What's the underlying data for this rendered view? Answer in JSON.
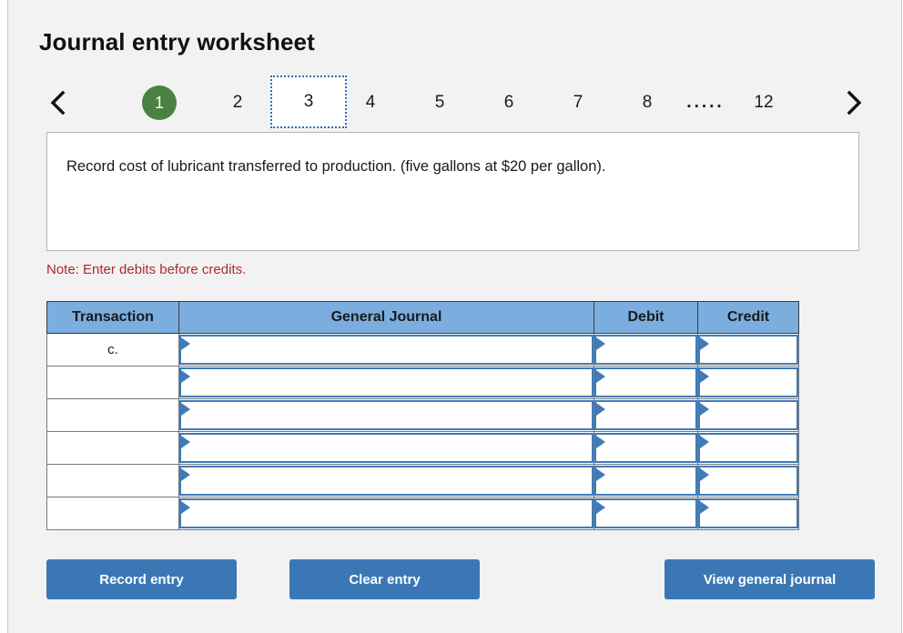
{
  "page": {
    "title": "Journal entry worksheet"
  },
  "pager": {
    "prev_icon": "chevron-left-icon",
    "next_icon": "chevron-right-icon",
    "ellipsis": ".....",
    "current_page": "1",
    "selected_page": "3",
    "items": [
      {
        "label": "1",
        "state": "current"
      },
      {
        "label": "2",
        "state": "normal"
      },
      {
        "label": "3",
        "state": "selected"
      },
      {
        "label": "4",
        "state": "normal"
      },
      {
        "label": "5",
        "state": "normal"
      },
      {
        "label": "6",
        "state": "normal"
      },
      {
        "label": "7",
        "state": "normal"
      },
      {
        "label": "8",
        "state": "normal"
      },
      {
        "label": "12",
        "state": "normal"
      }
    ],
    "current_color": "#4a8041",
    "selected_border_color": "#2e6fb7"
  },
  "description": {
    "text": "Record cost of lubricant transferred to production. (five gallons at $20 per gallon)."
  },
  "note": {
    "text": "Note: Enter debits before credits.",
    "color": "#b02a2a"
  },
  "table": {
    "headers": {
      "transaction": "Transaction",
      "general_journal": "General Journal",
      "debit": "Debit",
      "credit": "Credit"
    },
    "header_bg": "#7badde",
    "field_border_color": "#3f7bba",
    "rows": [
      {
        "transaction": "c.",
        "general_journal": "",
        "debit": "",
        "credit": ""
      },
      {
        "transaction": "",
        "general_journal": "",
        "debit": "",
        "credit": ""
      },
      {
        "transaction": "",
        "general_journal": "",
        "debit": "",
        "credit": ""
      },
      {
        "transaction": "",
        "general_journal": "",
        "debit": "",
        "credit": ""
      },
      {
        "transaction": "",
        "general_journal": "",
        "debit": "",
        "credit": ""
      },
      {
        "transaction": "",
        "general_journal": "",
        "debit": "",
        "credit": ""
      }
    ]
  },
  "buttons": {
    "record": "Record entry",
    "clear": "Clear entry",
    "view": "View general journal",
    "color": "#3b77b5"
  }
}
